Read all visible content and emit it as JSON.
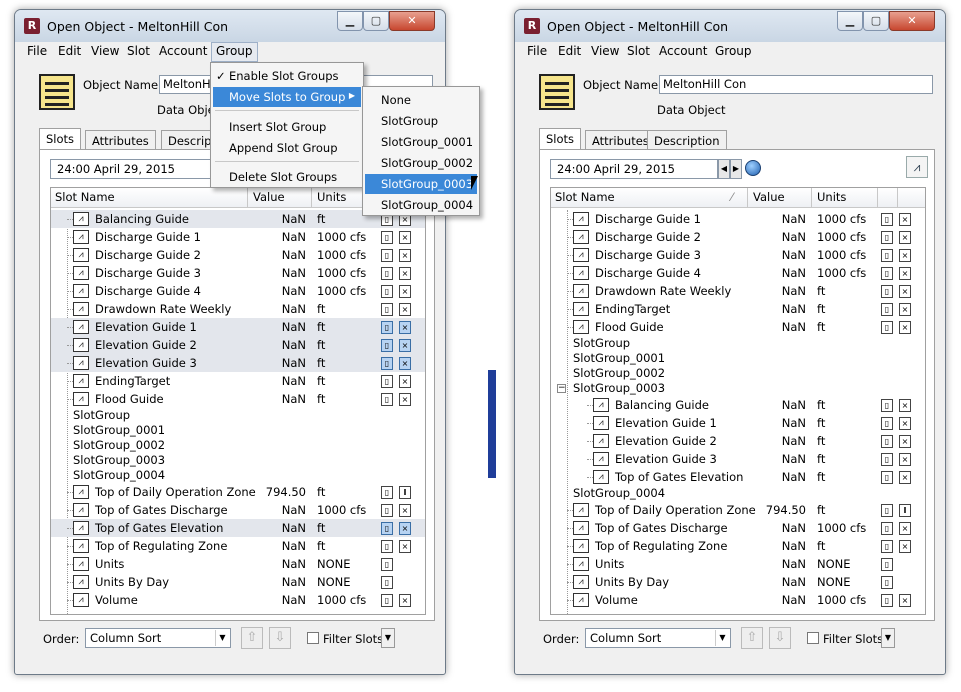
{
  "left": {
    "title": "Open Object - MeltonHill Con",
    "menus": [
      "File",
      "Edit",
      "View",
      "Slot",
      "Account",
      "Group"
    ],
    "object_name_label": "Object Name:",
    "object_name_value": "MeltonHill",
    "data_object_label": "Data Objec",
    "tabs": [
      "Slots",
      "Attributes",
      "Description"
    ],
    "date": "24:00 April 29, 2015",
    "headers": {
      "name": "Slot Name",
      "value": "Value",
      "units": "Units"
    },
    "rows": [
      {
        "name": "Balancing Guide",
        "value": "NaN",
        "units": "ft",
        "icons": 2,
        "hl": false,
        "sel": true,
        "indent": true
      },
      {
        "name": "Discharge Guide 1",
        "value": "NaN",
        "units": "1000 cfs",
        "icons": 2,
        "hl": false,
        "sel": false,
        "indent": true
      },
      {
        "name": "Discharge Guide 2",
        "value": "NaN",
        "units": "1000 cfs",
        "icons": 2,
        "hl": false,
        "sel": false,
        "indent": true
      },
      {
        "name": "Discharge Guide 3",
        "value": "NaN",
        "units": "1000 cfs",
        "icons": 2,
        "hl": false,
        "sel": false,
        "indent": true
      },
      {
        "name": "Discharge Guide 4",
        "value": "NaN",
        "units": "1000 cfs",
        "icons": 2,
        "hl": false,
        "sel": false,
        "indent": true
      },
      {
        "name": "Drawdown Rate Weekly",
        "value": "NaN",
        "units": "ft",
        "icons": 2,
        "hl": false,
        "sel": false,
        "indent": true
      },
      {
        "name": "Elevation Guide 1",
        "value": "NaN",
        "units": "ft",
        "icons": 2,
        "hl": true,
        "sel": true,
        "indent": true
      },
      {
        "name": "Elevation Guide 2",
        "value": "NaN",
        "units": "ft",
        "icons": 2,
        "hl": true,
        "sel": true,
        "indent": true
      },
      {
        "name": "Elevation Guide 3",
        "value": "NaN",
        "units": "ft",
        "icons": 2,
        "hl": true,
        "sel": true,
        "indent": true
      },
      {
        "name": "EndingTarget",
        "value": "NaN",
        "units": "ft",
        "icons": 2,
        "hl": false,
        "sel": false,
        "indent": true
      },
      {
        "name": "Flood Guide",
        "value": "NaN",
        "units": "ft",
        "icons": 2,
        "hl": false,
        "sel": false,
        "indent": true
      },
      {
        "name": "SlotGroup",
        "group": true
      },
      {
        "name": "SlotGroup_0001",
        "group": true
      },
      {
        "name": "SlotGroup_0002",
        "group": true
      },
      {
        "name": "SlotGroup_0003",
        "group": true
      },
      {
        "name": "SlotGroup_0004",
        "group": true
      },
      {
        "name": "Top of Daily Operation Zone",
        "value": "794.50",
        "units": "ft",
        "icons": 2,
        "hl": false,
        "sel": false,
        "indent": true,
        "bold": true
      },
      {
        "name": "Top of Gates Discharge",
        "value": "NaN",
        "units": "1000 cfs",
        "icons": 2,
        "hl": false,
        "sel": false,
        "indent": true
      },
      {
        "name": "Top of Gates Elevation",
        "value": "NaN",
        "units": "ft",
        "icons": 2,
        "hl": true,
        "sel": true,
        "indent": true
      },
      {
        "name": "Top of Regulating Zone",
        "value": "NaN",
        "units": "ft",
        "icons": 2,
        "hl": false,
        "sel": false,
        "indent": true
      },
      {
        "name": "Units",
        "value": "NaN",
        "units": "NONE",
        "icons": 1,
        "hl": false,
        "sel": false,
        "indent": true
      },
      {
        "name": "Units By Day",
        "value": "NaN",
        "units": "NONE",
        "icons": 1,
        "hl": false,
        "sel": false,
        "indent": true
      },
      {
        "name": "Volume",
        "value": "NaN",
        "units": "1000 cfs",
        "icons": 2,
        "hl": false,
        "sel": false,
        "indent": true
      }
    ],
    "group_menu": {
      "items": [
        "Enable Slot Groups",
        "Move Slots to Group",
        "Insert Slot Group",
        "Append Slot Group",
        "Delete Slot Groups"
      ],
      "check": "✓",
      "submenu_arrow": "▶"
    },
    "submenu": [
      "None",
      "SlotGroup",
      "SlotGroup_0001",
      "SlotGroup_0002",
      "SlotGroup_0003",
      "SlotGroup_0004"
    ],
    "order_label": "Order:",
    "order_value": "Column Sort",
    "filter_label": "Filter Slots"
  },
  "right": {
    "title": "Open Object - MeltonHill Con",
    "menus": [
      "File",
      "Edit",
      "View",
      "Slot",
      "Account",
      "Group"
    ],
    "object_name_label": "Object Name:",
    "object_name_value": "MeltonHill Con",
    "data_object_label": "Data Object",
    "tabs": [
      "Slots",
      "Attributes",
      "Description"
    ],
    "date": "24:00 April 29, 2015",
    "headers": {
      "name": "Slot Name",
      "value": "Value",
      "units": "Units"
    },
    "rows": [
      {
        "name": "Discharge Guide 1",
        "value": "NaN",
        "units": "1000 cfs",
        "icons": 2,
        "lvl": 1
      },
      {
        "name": "Discharge Guide 2",
        "value": "NaN",
        "units": "1000 cfs",
        "icons": 2,
        "lvl": 1
      },
      {
        "name": "Discharge Guide 3",
        "value": "NaN",
        "units": "1000 cfs",
        "icons": 2,
        "lvl": 1
      },
      {
        "name": "Discharge Guide 4",
        "value": "NaN",
        "units": "1000 cfs",
        "icons": 2,
        "lvl": 1
      },
      {
        "name": "Drawdown Rate Weekly",
        "value": "NaN",
        "units": "ft",
        "icons": 2,
        "lvl": 1
      },
      {
        "name": "EndingTarget",
        "value": "NaN",
        "units": "ft",
        "icons": 2,
        "lvl": 1
      },
      {
        "name": "Flood Guide",
        "value": "NaN",
        "units": "ft",
        "icons": 2,
        "lvl": 1
      },
      {
        "name": "SlotGroup",
        "group": true
      },
      {
        "name": "SlotGroup_0001",
        "group": true
      },
      {
        "name": "SlotGroup_0002",
        "group": true
      },
      {
        "name": "SlotGroup_0003",
        "group": true,
        "expanded": true
      },
      {
        "name": "Balancing Guide",
        "value": "NaN",
        "units": "ft",
        "icons": 2,
        "lvl": 2
      },
      {
        "name": "Elevation Guide 1",
        "value": "NaN",
        "units": "ft",
        "icons": 2,
        "lvl": 2
      },
      {
        "name": "Elevation Guide 2",
        "value": "NaN",
        "units": "ft",
        "icons": 2,
        "lvl": 2
      },
      {
        "name": "Elevation Guide 3",
        "value": "NaN",
        "units": "ft",
        "icons": 2,
        "lvl": 2
      },
      {
        "name": "Top of Gates Elevation",
        "value": "NaN",
        "units": "ft",
        "icons": 2,
        "lvl": 2
      },
      {
        "name": "SlotGroup_0004",
        "group": true
      },
      {
        "name": "Top of Daily Operation Zone",
        "value": "794.50",
        "units": "ft",
        "icons": 2,
        "lvl": 1,
        "bold": true
      },
      {
        "name": "Top of Gates Discharge",
        "value": "NaN",
        "units": "1000 cfs",
        "icons": 2,
        "lvl": 1
      },
      {
        "name": "Top of Regulating Zone",
        "value": "NaN",
        "units": "ft",
        "icons": 2,
        "lvl": 1
      },
      {
        "name": "Units",
        "value": "NaN",
        "units": "NONE",
        "icons": 1,
        "lvl": 1
      },
      {
        "name": "Units By Day",
        "value": "NaN",
        "units": "NONE",
        "icons": 1,
        "lvl": 1
      },
      {
        "name": "Volume",
        "value": "NaN",
        "units": "1000 cfs",
        "icons": 2,
        "lvl": 1
      }
    ],
    "order_label": "Order:",
    "order_value": "Column Sort",
    "filter_label": "Filter Slots"
  },
  "colors": {
    "menu_highlight": "#3b88d8",
    "selection_bg": "#e3e6ec",
    "divider": "#1f3d99"
  }
}
